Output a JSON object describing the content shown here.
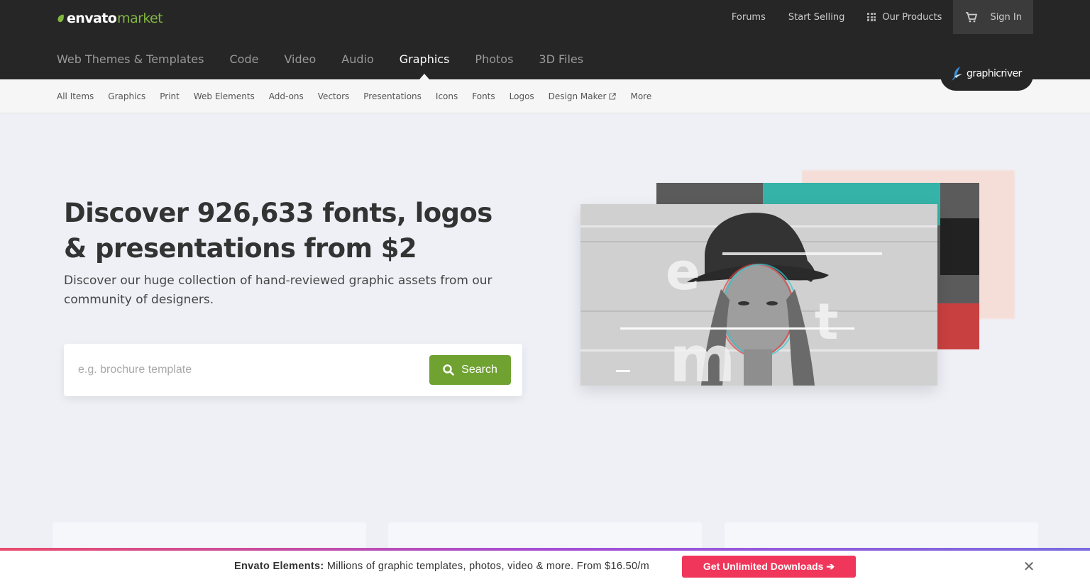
{
  "header": {
    "brand": "envato",
    "brand_suffix": "market",
    "links": {
      "forums": "Forums",
      "start_selling": "Start Selling",
      "our_products": "Our Products",
      "sign_in": "Sign In"
    }
  },
  "main_nav": {
    "items": [
      "Web Themes & Templates",
      "Code",
      "Video",
      "Audio",
      "Graphics",
      "Photos",
      "3D Files"
    ],
    "active": "Graphics"
  },
  "sub_nav": {
    "items": [
      "All Items",
      "Graphics",
      "Print",
      "Web Elements",
      "Add-ons",
      "Vectors",
      "Presentations",
      "Icons",
      "Fonts",
      "Logos",
      "Design Maker",
      "More"
    ]
  },
  "site_badge": "graphicriver",
  "hero": {
    "title": "Discover 926,633 fonts, logos & presentations from $2",
    "subtitle": "Discover our huge collection of hand-reviewed graphic assets from our community of designers.",
    "search_placeholder": "e.g. brochure template",
    "search_button": "Search"
  },
  "banner": {
    "brand": "Envato Elements:",
    "text": "Millions of graphic templates, photos, video & more. From $16.50/m",
    "cta": "Get Unlimited Downloads ➔",
    "close": "✕"
  },
  "colors": {
    "accent_green": "#82b541",
    "search_green": "#70a232",
    "cta_red": "#f0365a",
    "dark_bg": "#262626"
  }
}
